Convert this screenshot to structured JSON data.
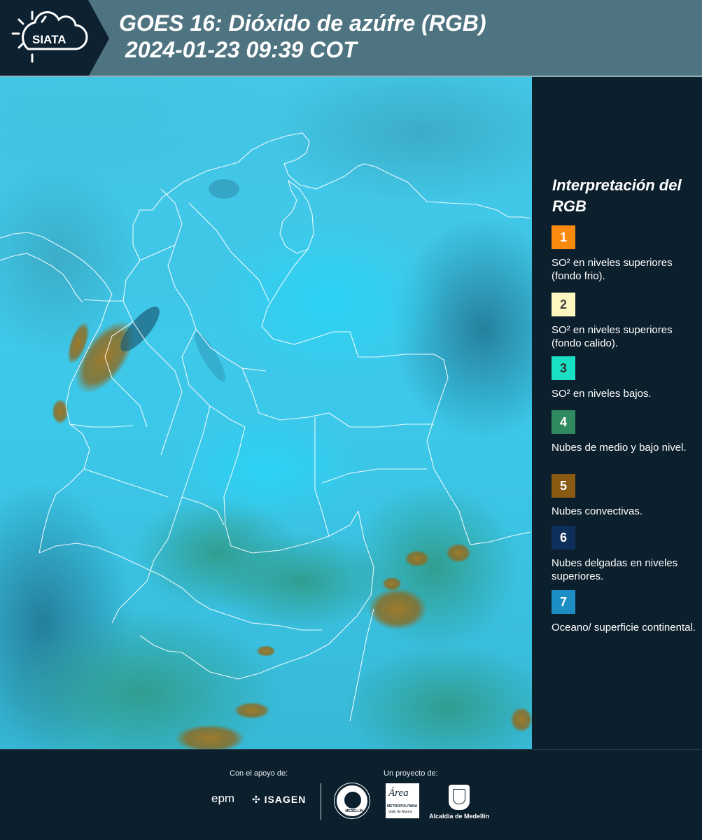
{
  "header": {
    "logo_text": "SIATA",
    "title_line1": "GOES 16: Dióxido de azúfre (RGB)",
    "title_line2": " 2024-01-23 09:39 COT"
  },
  "legend": {
    "title": "Interpretación del RGB",
    "items": [
      {
        "number": "1",
        "label": "SO² en niveles superiores (fondo frio).",
        "color": "#f88a10",
        "number_color": "#ffffff"
      },
      {
        "number": "2",
        "label": "SO² en niveles superiores (fondo calido).",
        "color": "#fff7c0",
        "number_color": "#444444"
      },
      {
        "number": "3",
        "label": "SO² en niveles bajos.",
        "color": "#19e0c4",
        "number_color": "#333333"
      },
      {
        "number": "4",
        "label": "Nubes de medio y bajo nivel.",
        "color": "#2f8a60",
        "number_color": "#ffffff"
      },
      {
        "number": "5",
        "label": "Nubes convectivas.",
        "color": "#8a5a12",
        "number_color": "#ffffff"
      },
      {
        "number": "6",
        "label": "Nubes delgadas en niveles superiores.",
        "color": "#0c2f5c",
        "number_color": "#ffffff"
      },
      {
        "number": "7",
        "label": "Oceano/ superficie continental.",
        "color": "#1c8ec4",
        "number_color": "#ffffff"
      }
    ]
  },
  "footer": {
    "support_label": "Con el apoyo de:",
    "project_label": "Un proyecto de:",
    "epm_text": "epm",
    "isagen_text": "ISAGEN",
    "area_text": "Área",
    "area_sub": "METROPOLITANA",
    "area_sub2": "Valle de Aburrá",
    "medellin_seal_text": "MEDELLÍN",
    "alcaldia_text": "Alcaldía de Medellín"
  },
  "colors": {
    "header_bg": "#4f7481",
    "panel_bg": "#0c1f2d",
    "map_base": "#3fc6e8"
  }
}
